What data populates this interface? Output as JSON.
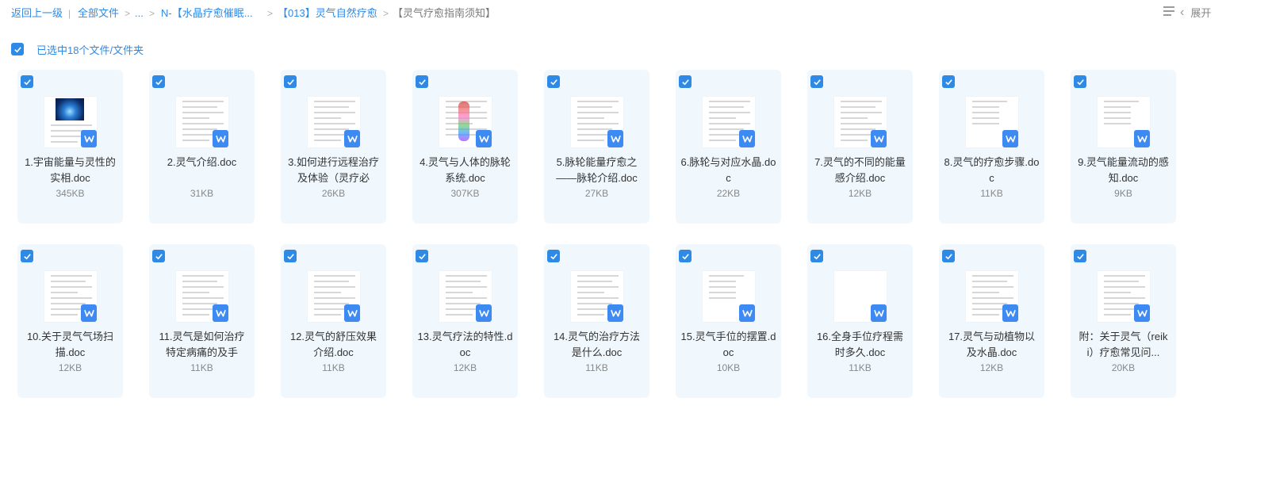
{
  "breadcrumb": {
    "back": "返回上一级",
    "all_files": "全部文件",
    "ellipsis": "...",
    "folder1": "N-【水晶疗愈催眠...",
    "folder2": "【013】灵气自然疗愈",
    "current": "【灵气疗愈指南须知】",
    "separator": ">",
    "divider": "|"
  },
  "toolbar": {
    "expand_label": "展开",
    "list_view_icon": "list-view-icon",
    "chevron_icon": "chevron-left-icon"
  },
  "selection": {
    "label": "已选中18个文件/文件夹",
    "checked": true
  },
  "colors": {
    "accent": "#2f8ae5",
    "card_bg": "#f0f8fe",
    "word_badge": "#3d8bf2"
  },
  "files": [
    {
      "name": "1.宇宙能量与灵性的实相.doc",
      "size": "345KB",
      "checked": true,
      "thumb": "image"
    },
    {
      "name": "2.灵气介绍.doc",
      "size": "31KB",
      "checked": true,
      "thumb": "text"
    },
    {
      "name": "3.如何进行远程治疗及体验（灵疗必",
      "size": "26KB",
      "checked": true,
      "thumb": "text"
    },
    {
      "name": "4.灵气与人体的脉轮系统.doc",
      "size": "307KB",
      "checked": true,
      "thumb": "chakra"
    },
    {
      "name": "5.脉轮能量疗愈之——脉轮介绍.doc",
      "size": "27KB",
      "checked": true,
      "thumb": "text"
    },
    {
      "name": "6.脉轮与对应水晶.doc",
      "size": "22KB",
      "checked": true,
      "thumb": "text"
    },
    {
      "name": "7.灵气的不同的能量感介绍.doc",
      "size": "12KB",
      "checked": true,
      "thumb": "text"
    },
    {
      "name": "8.灵气的疗愈步骤.doc",
      "size": "11KB",
      "checked": true,
      "thumb": "sparse"
    },
    {
      "name": "9.灵气能量流动的感知.doc",
      "size": "9KB",
      "checked": true,
      "thumb": "sparse"
    },
    {
      "name": "10.关于灵气气场扫描.doc",
      "size": "12KB",
      "checked": true,
      "thumb": "text"
    },
    {
      "name": "11.灵气是如何治疗特定病痛的及手",
      "size": "11KB",
      "checked": true,
      "thumb": "text"
    },
    {
      "name": "12.灵气的舒压效果介绍.doc",
      "size": "11KB",
      "checked": true,
      "thumb": "text"
    },
    {
      "name": "13.灵气疗法的特性.doc",
      "size": "12KB",
      "checked": true,
      "thumb": "text"
    },
    {
      "name": "14.灵气的治疗方法是什么.doc",
      "size": "11KB",
      "checked": true,
      "thumb": "text"
    },
    {
      "name": "15.灵气手位的摆置.doc",
      "size": "10KB",
      "checked": true,
      "thumb": "sparse"
    },
    {
      "name": "16.全身手位疗程需时多久.doc",
      "size": "11KB",
      "checked": true,
      "thumb": "blank"
    },
    {
      "name": "17.灵气与动植物以及水晶.doc",
      "size": "12KB",
      "checked": true,
      "thumb": "text"
    },
    {
      "name": "附：关于灵气（reiki）疗愈常见问...",
      "size": "20KB",
      "checked": true,
      "thumb": "text"
    }
  ]
}
